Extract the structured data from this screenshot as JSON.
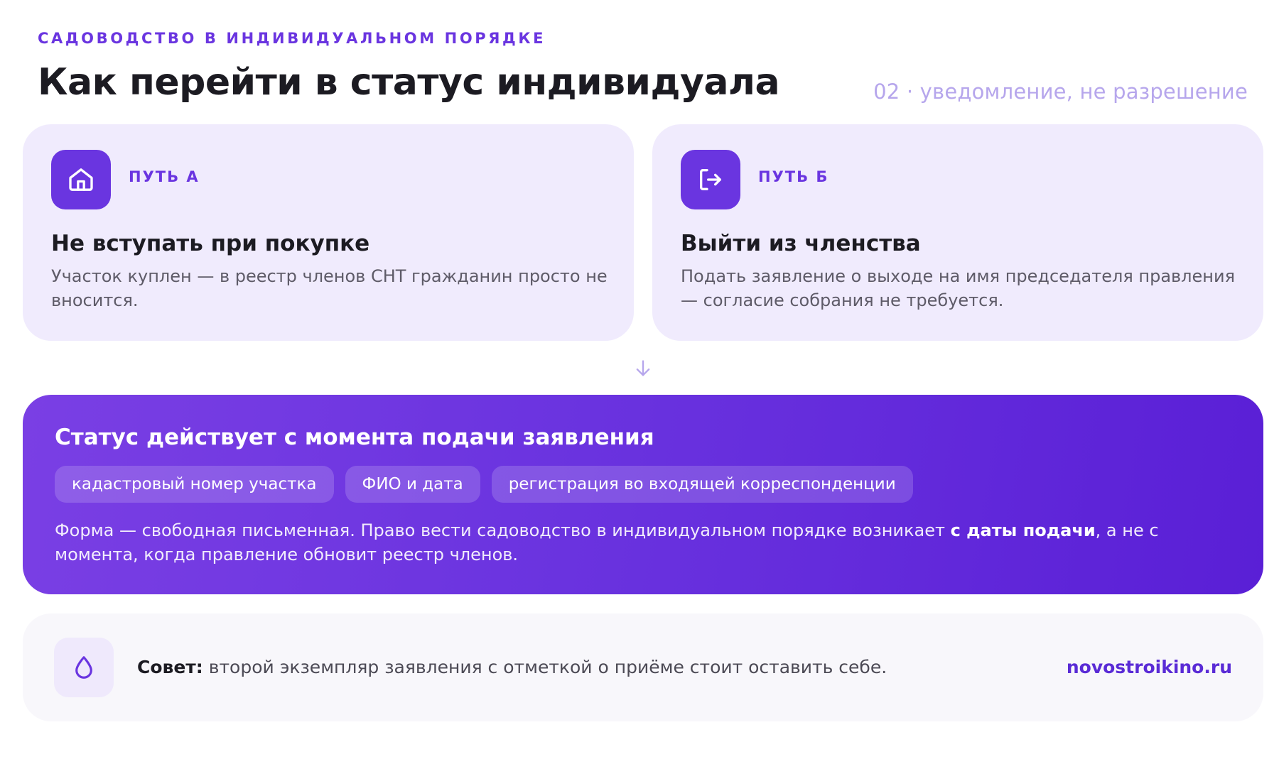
{
  "header": {
    "eyebrow": "САДОВОДСТВО В ИНДИВИДУАЛЬНОМ ПОРЯДКЕ",
    "title": "Как перейти в статус индивидуала",
    "badge": "02 · уведомление, не разрешение"
  },
  "paths": [
    {
      "icon": "home-icon",
      "label": "ПУТЬ А",
      "title": "Не вступать при покупке",
      "text": "Участок куплен — в реестр членов СНТ гражданин просто не вносится."
    },
    {
      "icon": "exit-icon",
      "label": "ПУТЬ Б",
      "title": "Выйти из членства",
      "text": "Подать заявление о выходе на имя председателя правления — согласие собрания не требуется."
    }
  ],
  "status": {
    "title": "Статус действует с момента подачи заявления",
    "chips": [
      "кадастровый номер участка",
      "ФИО и дата",
      "регистрация во входящей корреспонденции"
    ],
    "text_before": "Форма — свободная письменная. Право вести садоводство в индивидуальном порядке возникает ",
    "text_bold": "с даты подачи",
    "text_after": ", а не с момента, когда правление обновит реестр членов."
  },
  "tip": {
    "icon": "drop-icon",
    "label": "Совет:",
    "text": " второй экземпляр заявления с отметкой о приёме стоит оставить себе.",
    "site": "novostroikino.ru"
  },
  "colors": {
    "accent": "#6a35e0",
    "card_bg": "#f0ebfd",
    "badge": "#b6a6ec",
    "status_gradient_start": "#7a3fe4",
    "status_gradient_end": "#5a1fd6",
    "tip_bg": "#f8f7fb"
  }
}
